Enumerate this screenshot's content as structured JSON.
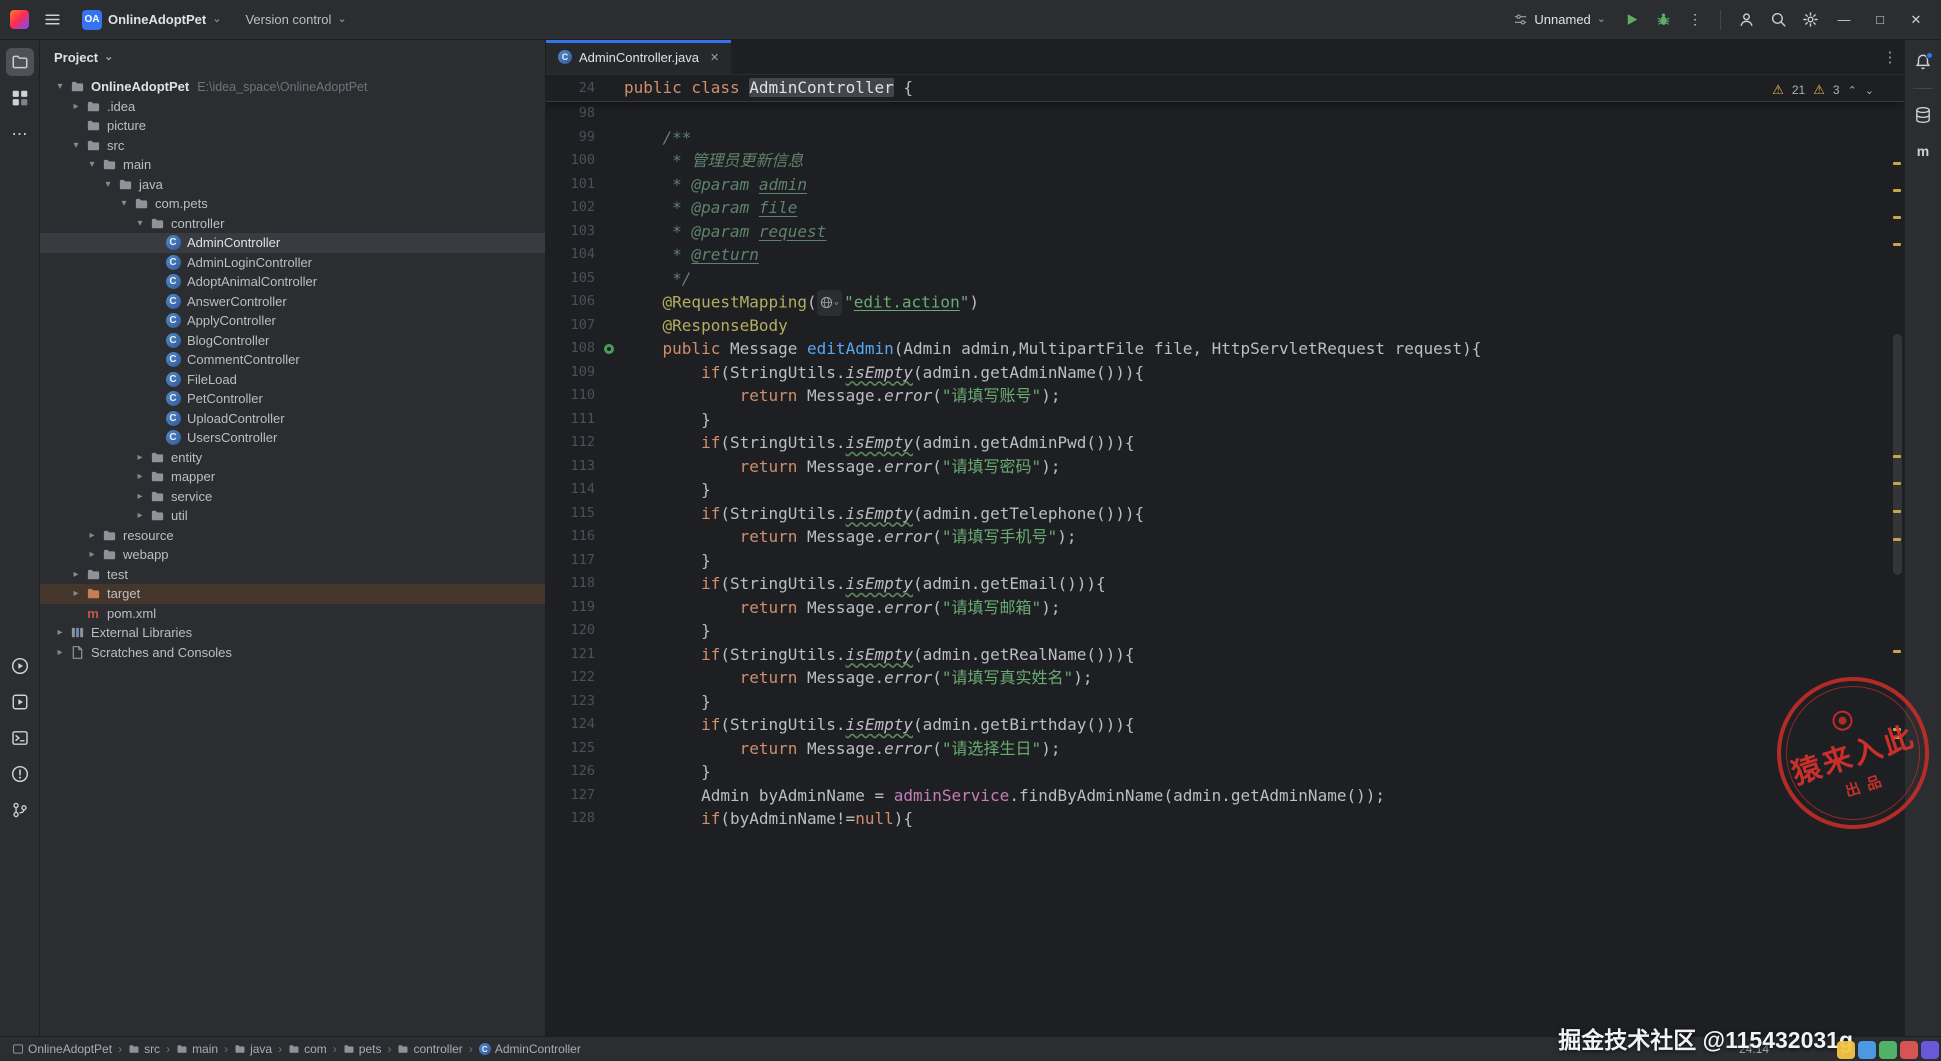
{
  "titlebar": {
    "project_badge": "OA",
    "project_name": "OnlineAdoptPet",
    "vcs_label": "Version control",
    "run_config": "Unnamed"
  },
  "glyphs": {
    "chevron_down": "⌄",
    "chevron_up": "⌃",
    "crumb_sep": "›",
    "more_v": "⋮",
    "more_h": "⋯",
    "warning": "⚠",
    "minimize": "—",
    "maximize": "□",
    "close": "✕",
    "tab_close": "✕"
  },
  "toolbars": {
    "left_top": [
      "project",
      "structure",
      "more"
    ],
    "left_bottom": [
      "run",
      "services",
      "terminal",
      "problems",
      "git"
    ],
    "right_top": [
      "notifications",
      "divider",
      "database",
      "maven"
    ]
  },
  "project": {
    "header": "Project",
    "items": [
      {
        "lv": 0,
        "ch": "o",
        "ic": "folder",
        "label": "OnlineAdoptPet",
        "extra": "E:\\idea_space\\OnlineAdoptPet",
        "bold": true
      },
      {
        "lv": 1,
        "ch": "c",
        "ic": "folder",
        "label": ".idea"
      },
      {
        "lv": 1,
        "ch": "n",
        "ic": "folder",
        "label": "picture"
      },
      {
        "lv": 1,
        "ch": "o",
        "ic": "folder",
        "label": "src"
      },
      {
        "lv": 2,
        "ch": "o",
        "ic": "folder",
        "label": "main"
      },
      {
        "lv": 3,
        "ch": "o",
        "ic": "folder",
        "label": "java"
      },
      {
        "lv": 4,
        "ch": "o",
        "ic": "package",
        "label": "com.pets"
      },
      {
        "lv": 5,
        "ch": "o",
        "ic": "package",
        "label": "controller"
      },
      {
        "lv": 6,
        "ch": "n",
        "ic": "class",
        "label": "AdminController",
        "sel": true
      },
      {
        "lv": 6,
        "ch": "n",
        "ic": "class",
        "label": "AdminLoginController"
      },
      {
        "lv": 6,
        "ch": "n",
        "ic": "class",
        "label": "AdoptAnimalController"
      },
      {
        "lv": 6,
        "ch": "n",
        "ic": "class",
        "label": "AnswerController"
      },
      {
        "lv": 6,
        "ch": "n",
        "ic": "class",
        "label": "ApplyController"
      },
      {
        "lv": 6,
        "ch": "n",
        "ic": "class",
        "label": "BlogController"
      },
      {
        "lv": 6,
        "ch": "n",
        "ic": "class",
        "label": "CommentController"
      },
      {
        "lv": 6,
        "ch": "n",
        "ic": "class",
        "label": "FileLoad"
      },
      {
        "lv": 6,
        "ch": "n",
        "ic": "class",
        "label": "PetController"
      },
      {
        "lv": 6,
        "ch": "n",
        "ic": "class",
        "label": "UploadController"
      },
      {
        "lv": 6,
        "ch": "n",
        "ic": "class",
        "label": "UsersController"
      },
      {
        "lv": 5,
        "ch": "c",
        "ic": "package",
        "label": "entity"
      },
      {
        "lv": 5,
        "ch": "c",
        "ic": "package",
        "label": "mapper"
      },
      {
        "lv": 5,
        "ch": "c",
        "ic": "package",
        "label": "service"
      },
      {
        "lv": 5,
        "ch": "c",
        "ic": "package",
        "label": "util"
      },
      {
        "lv": 2,
        "ch": "c",
        "ic": "folder",
        "label": "resource"
      },
      {
        "lv": 2,
        "ch": "c",
        "ic": "folder",
        "label": "webapp"
      },
      {
        "lv": 1,
        "ch": "c",
        "ic": "folder",
        "label": "test"
      },
      {
        "lv": 1,
        "ch": "c",
        "ic": "folder-ex",
        "label": "target",
        "excluded": true
      },
      {
        "lv": 1,
        "ch": "n",
        "ic": "maven",
        "label": "pom.xml"
      },
      {
        "lv": 0,
        "ch": "c",
        "ic": "lib",
        "label": "External Libraries"
      },
      {
        "lv": 0,
        "ch": "c",
        "ic": "scratch",
        "label": "Scratches and Consoles"
      }
    ]
  },
  "editor": {
    "tab_label": "AdminController.java",
    "inspections": {
      "warnings": "21",
      "weak_warnings": "3"
    },
    "sticky": {
      "n": "24",
      "seg": [
        [
          "public class ",
          "k"
        ],
        [
          "AdminController",
          "hl"
        ],
        [
          " {",
          "d"
        ]
      ]
    },
    "lines": [
      {
        "n": "98",
        "seg": []
      },
      {
        "n": "99",
        "seg": [
          [
            "    /**",
            "c"
          ]
        ]
      },
      {
        "n": "100",
        "seg": [
          [
            "     * 管理员更新信息",
            "c"
          ]
        ]
      },
      {
        "n": "101",
        "seg": [
          [
            "     * ",
            "c"
          ],
          [
            "@param",
            "ct"
          ],
          [
            " ",
            "c"
          ],
          [
            "admin",
            "cu"
          ]
        ]
      },
      {
        "n": "102",
        "seg": [
          [
            "     * ",
            "c"
          ],
          [
            "@param",
            "ct"
          ],
          [
            " ",
            "c"
          ],
          [
            "file",
            "cu"
          ]
        ]
      },
      {
        "n": "103",
        "seg": [
          [
            "     * ",
            "c"
          ],
          [
            "@param",
            "ct"
          ],
          [
            " ",
            "c"
          ],
          [
            "request",
            "cu"
          ]
        ]
      },
      {
        "n": "104",
        "seg": [
          [
            "     * ",
            "c"
          ],
          [
            "@return",
            "ctu"
          ]
        ]
      },
      {
        "n": "105",
        "seg": [
          [
            "     */",
            "c"
          ]
        ]
      },
      {
        "n": "106",
        "seg": [
          [
            "    ",
            "d"
          ],
          [
            "@RequestMapping",
            "a"
          ],
          [
            "(",
            "d"
          ],
          [
            "",
            "globe"
          ],
          [
            "\"",
            "s"
          ],
          [
            "edit.action",
            "su"
          ],
          [
            "\"",
            "s"
          ],
          [
            ")",
            "d"
          ]
        ]
      },
      {
        "n": "107",
        "seg": [
          [
            "    ",
            "d"
          ],
          [
            "@ResponseBody",
            "a"
          ]
        ]
      },
      {
        "n": "108",
        "gut": "spring",
        "seg": [
          [
            "    ",
            "d"
          ],
          [
            "public ",
            "k"
          ],
          [
            "Message ",
            "d"
          ],
          [
            "editAdmin",
            "m"
          ],
          [
            "(Admin admin,MultipartFile file, HttpServletRequest request){",
            "d"
          ]
        ]
      },
      {
        "n": "109",
        "seg": [
          [
            "        ",
            "d"
          ],
          [
            "if",
            "k"
          ],
          [
            "(StringUtils.",
            "d"
          ],
          [
            "isEmpty",
            "smw"
          ],
          [
            "(admin.getAdminName())){",
            "d"
          ]
        ]
      },
      {
        "n": "110",
        "seg": [
          [
            "            ",
            "d"
          ],
          [
            "return ",
            "k"
          ],
          [
            "Message.",
            "d"
          ],
          [
            "error",
            "sm"
          ],
          [
            "(",
            "d"
          ],
          [
            "\"请填写账号\"",
            "s"
          ],
          [
            ");",
            "d"
          ]
        ]
      },
      {
        "n": "111",
        "seg": [
          [
            "        }",
            "d"
          ]
        ]
      },
      {
        "n": "112",
        "seg": [
          [
            "        ",
            "d"
          ],
          [
            "if",
            "k"
          ],
          [
            "(StringUtils.",
            "d"
          ],
          [
            "isEmpty",
            "smw"
          ],
          [
            "(admin.getAdminPwd())){",
            "d"
          ]
        ]
      },
      {
        "n": "113",
        "seg": [
          [
            "            ",
            "d"
          ],
          [
            "return ",
            "k"
          ],
          [
            "Message.",
            "d"
          ],
          [
            "error",
            "sm"
          ],
          [
            "(",
            "d"
          ],
          [
            "\"请填写密码\"",
            "s"
          ],
          [
            ");",
            "d"
          ]
        ]
      },
      {
        "n": "114",
        "seg": [
          [
            "        }",
            "d"
          ]
        ]
      },
      {
        "n": "115",
        "seg": [
          [
            "        ",
            "d"
          ],
          [
            "if",
            "k"
          ],
          [
            "(StringUtils.",
            "d"
          ],
          [
            "isEmpty",
            "smw"
          ],
          [
            "(admin.getTelephone())){",
            "d"
          ]
        ]
      },
      {
        "n": "116",
        "seg": [
          [
            "            ",
            "d"
          ],
          [
            "return ",
            "k"
          ],
          [
            "Message.",
            "d"
          ],
          [
            "error",
            "sm"
          ],
          [
            "(",
            "d"
          ],
          [
            "\"请填写手机号\"",
            "s"
          ],
          [
            ");",
            "d"
          ]
        ]
      },
      {
        "n": "117",
        "seg": [
          [
            "        }",
            "d"
          ]
        ]
      },
      {
        "n": "118",
        "seg": [
          [
            "        ",
            "d"
          ],
          [
            "if",
            "k"
          ],
          [
            "(StringUtils.",
            "d"
          ],
          [
            "isEmpty",
            "smw"
          ],
          [
            "(admin.getEmail())){",
            "d"
          ]
        ]
      },
      {
        "n": "119",
        "seg": [
          [
            "            ",
            "d"
          ],
          [
            "return ",
            "k"
          ],
          [
            "Message.",
            "d"
          ],
          [
            "error",
            "sm"
          ],
          [
            "(",
            "d"
          ],
          [
            "\"请填写邮箱\"",
            "s"
          ],
          [
            ");",
            "d"
          ]
        ]
      },
      {
        "n": "120",
        "seg": [
          [
            "        }",
            "d"
          ]
        ]
      },
      {
        "n": "121",
        "seg": [
          [
            "        ",
            "d"
          ],
          [
            "if",
            "k"
          ],
          [
            "(StringUtils.",
            "d"
          ],
          [
            "isEmpty",
            "smw"
          ],
          [
            "(admin.getRealName())){",
            "d"
          ]
        ]
      },
      {
        "n": "122",
        "seg": [
          [
            "            ",
            "d"
          ],
          [
            "return ",
            "k"
          ],
          [
            "Message.",
            "d"
          ],
          [
            "error",
            "sm"
          ],
          [
            "(",
            "d"
          ],
          [
            "\"请填写真实姓名\"",
            "s"
          ],
          [
            ");",
            "d"
          ]
        ]
      },
      {
        "n": "123",
        "seg": [
          [
            "        }",
            "d"
          ]
        ]
      },
      {
        "n": "124",
        "seg": [
          [
            "        ",
            "d"
          ],
          [
            "if",
            "k"
          ],
          [
            "(StringUtils.",
            "d"
          ],
          [
            "isEmpty",
            "smw"
          ],
          [
            "(admin.getBirthday())){",
            "d"
          ]
        ]
      },
      {
        "n": "125",
        "seg": [
          [
            "            ",
            "d"
          ],
          [
            "return ",
            "k"
          ],
          [
            "Message.",
            "d"
          ],
          [
            "error",
            "sm"
          ],
          [
            "(",
            "d"
          ],
          [
            "\"请选择生日\"",
            "s"
          ],
          [
            ");",
            "d"
          ]
        ]
      },
      {
        "n": "126",
        "seg": [
          [
            "        }",
            "d"
          ]
        ]
      },
      {
        "n": "127",
        "seg": [
          [
            "        Admin byAdminName = ",
            "d"
          ],
          [
            "adminService",
            "f"
          ],
          [
            ".findByAdminName(admin.getAdminName());",
            "d"
          ]
        ]
      },
      {
        "n": "128",
        "seg": [
          [
            "        ",
            "d"
          ],
          [
            "if",
            "k"
          ],
          [
            "(byAdminName!=",
            "d"
          ],
          [
            "null",
            "k"
          ],
          [
            "){",
            "d"
          ]
        ]
      }
    ],
    "stripe_ticks": [
      9.1,
      11.9,
      14.7,
      17.5,
      39.5,
      42.4,
      45.3,
      48.2,
      59.8,
      68.0,
      68.8
    ]
  },
  "status": {
    "crumbs": [
      {
        "icon": "project",
        "label": "OnlineAdoptPet"
      },
      {
        "icon": "folder",
        "label": "src"
      },
      {
        "icon": "folder",
        "label": "main"
      },
      {
        "icon": "folder",
        "label": "java"
      },
      {
        "icon": "folder",
        "label": "com"
      },
      {
        "icon": "folder",
        "label": "pets"
      },
      {
        "icon": "folder",
        "label": "controller"
      },
      {
        "icon": "class",
        "label": "AdminController"
      }
    ],
    "cursor": "24:14"
  },
  "watermark": {
    "community": "掘金技术社区 @115432031g",
    "stamp_main": "猿来入此",
    "stamp_sub": "出品",
    "sticker_colors": [
      "#F6C445",
      "#4D9FEB",
      "#53B86A",
      "#E05656",
      "#6F5BE3"
    ]
  }
}
